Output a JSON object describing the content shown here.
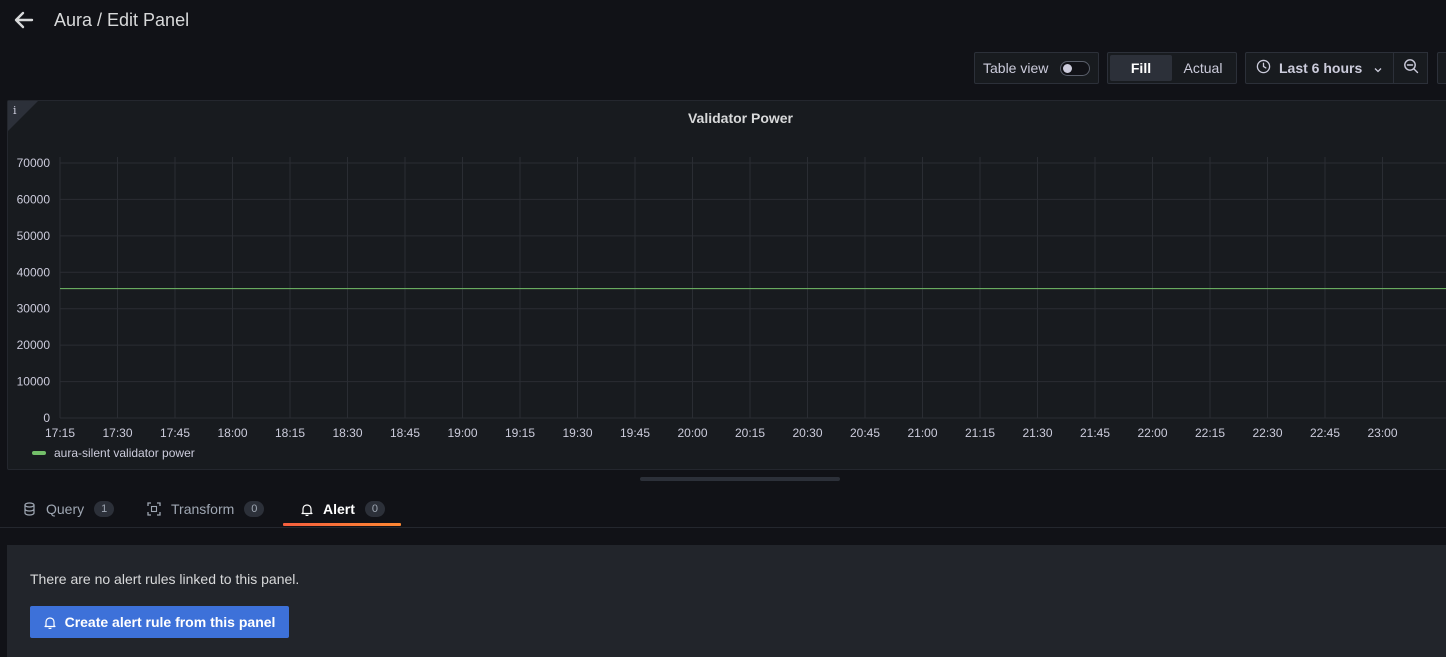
{
  "header": {
    "back_icon": "arrow-left-icon",
    "title": "Aura / Edit Panel"
  },
  "toolbar": {
    "table_view_label": "Table view",
    "table_view_enabled": false,
    "fill_label": "Fill",
    "actual_label": "Actual",
    "time_range_label": "Last 6 hours",
    "time_icon": "clock-icon",
    "zoom_icon": "zoom-out-icon"
  },
  "panel": {
    "title": "Validator Power",
    "info_icon": "info-icon"
  },
  "chart_data": {
    "type": "line",
    "title": "Validator Power",
    "xlabel": "",
    "ylabel": "",
    "x_ticks": [
      "17:15",
      "17:30",
      "17:45",
      "18:00",
      "18:15",
      "18:30",
      "18:45",
      "19:00",
      "19:15",
      "19:30",
      "19:45",
      "20:00",
      "20:15",
      "20:30",
      "20:45",
      "21:00",
      "21:15",
      "21:30",
      "21:45",
      "22:00",
      "22:15",
      "22:30",
      "22:45",
      "23:00"
    ],
    "y_ticks": [
      0,
      10000,
      20000,
      30000,
      40000,
      50000,
      60000,
      70000
    ],
    "ylim": [
      0,
      70000
    ],
    "grid": true,
    "legend": "bottom-left",
    "series": [
      {
        "name": "aura-silent validator power",
        "color": "#73bf69",
        "x": [
          "17:15",
          "23:00"
        ],
        "values": [
          35500,
          35500
        ]
      }
    ]
  },
  "tabs": [
    {
      "label": "Query",
      "count": "1",
      "icon": "database-icon"
    },
    {
      "label": "Transform",
      "count": "0",
      "icon": "transform-icon"
    },
    {
      "label": "Alert",
      "count": "0",
      "icon": "bell-icon",
      "active": true
    }
  ],
  "alert": {
    "message": "There are no alert rules linked to this panel.",
    "create_button_label": "Create alert rule from this panel"
  }
}
